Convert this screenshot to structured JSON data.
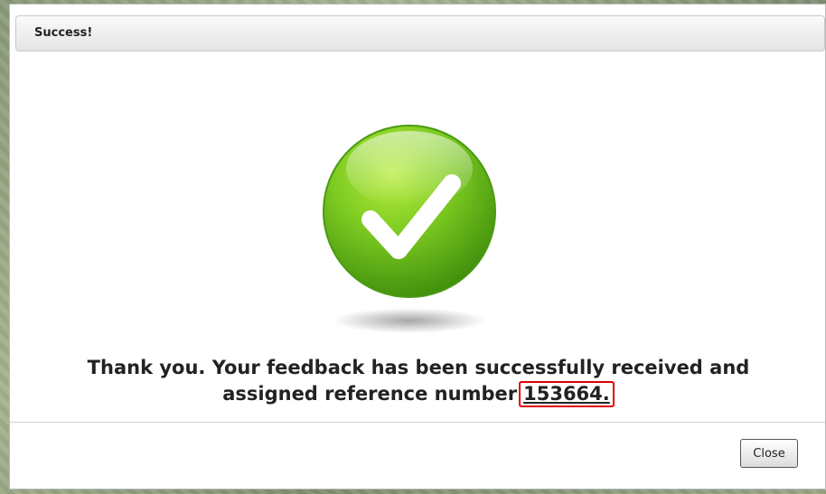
{
  "dialog": {
    "title": "Success!",
    "icon": "checkmark-icon",
    "message_line1": "Thank you. Your feedback has been successfully received and",
    "message_line2": "assigned reference number",
    "reference_number": "153664.",
    "close_label": "Close"
  },
  "colors": {
    "success_green": "#6fbf1d",
    "highlight_border": "#e00000"
  }
}
